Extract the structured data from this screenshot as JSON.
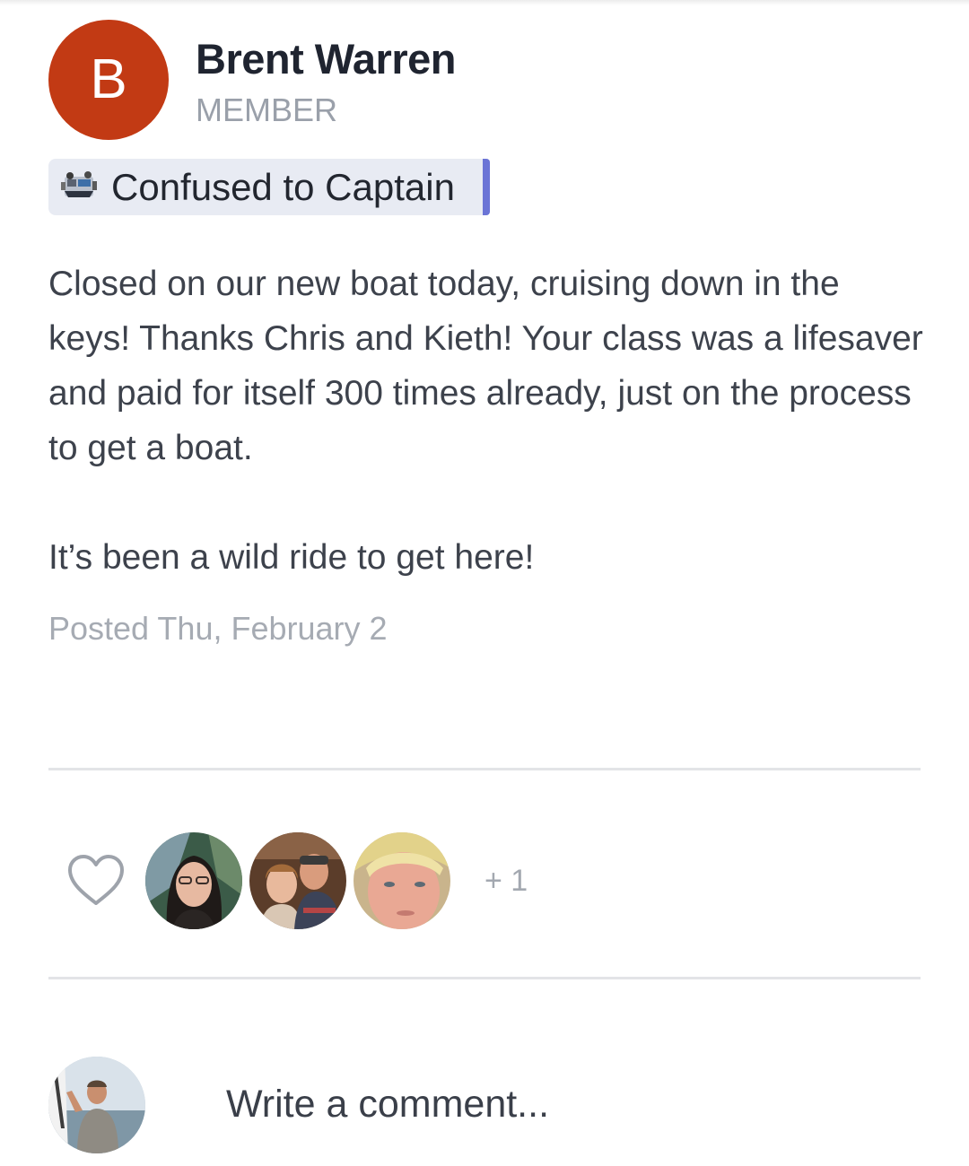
{
  "colors": {
    "avatar_bg": "#c23a14",
    "tag_accent": "#6b74d6",
    "heart_stroke": "#9ea3ab"
  },
  "author": {
    "initial": "B",
    "name": "Brent Warren",
    "role": "MEMBER"
  },
  "tag": {
    "icon": "boat-group-photo-icon",
    "label": "Confused to Captain"
  },
  "post": {
    "paragraphs": [
      "Closed on our new boat today, cruising down in the keys! Thanks Chris and Kieth! Your class was a lifesaver and paid for itself 300 times already, just on the process to get a boat.",
      "It’s been a wild ride to get here!"
    ],
    "posted": "Posted Thu, February 2"
  },
  "reactions": {
    "like_icon": "heart-outline-icon",
    "likers": [
      {
        "name": "liker-avatar-1"
      },
      {
        "name": "liker-avatar-2"
      },
      {
        "name": "liker-avatar-3"
      }
    ],
    "more_count": "+ 1"
  },
  "comment": {
    "placeholder": "Write a comment..."
  }
}
